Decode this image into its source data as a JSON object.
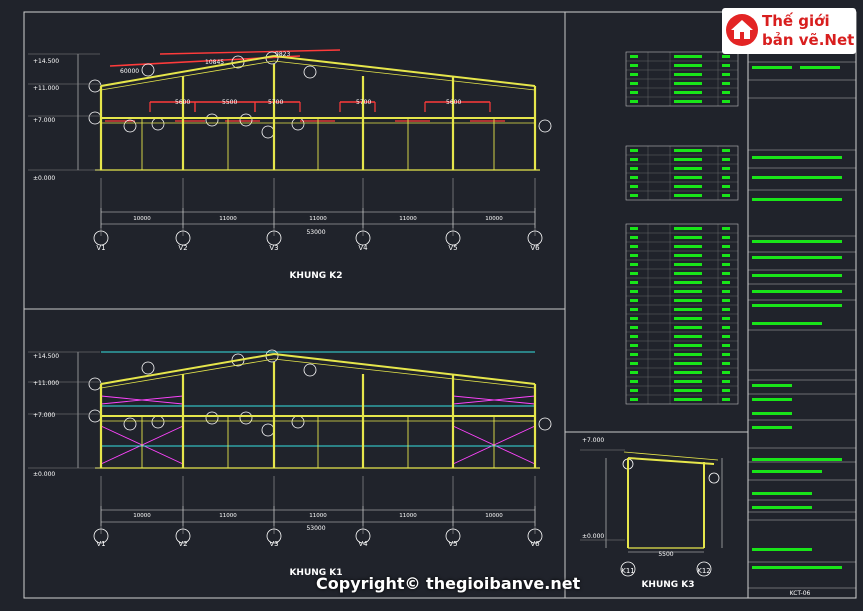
{
  "logo": {
    "line1": "Thế giới",
    "line2": "bản vẽ.Net"
  },
  "copyright": "Copyright© thegioibanve.net",
  "frames": {
    "k2": {
      "title": "KHUNG K2",
      "total": "53000",
      "bays": [
        "10000",
        "11000",
        "11000",
        "11000",
        "10000"
      ]
    },
    "k1": {
      "title": "KHUNG K1",
      "total": "53000",
      "bays": [
        "10000",
        "11000",
        "11000",
        "11000",
        "10000"
      ]
    },
    "k3": {
      "title": "KHUNG K3",
      "span": "5500"
    }
  },
  "levels": [
    "+14.500",
    "+11.000",
    "+7.000",
    "±0.000"
  ],
  "k3_levels": [
    "+7.000",
    "±0.000"
  ],
  "grid_axes": [
    "V1",
    "V2",
    "V3",
    "V4",
    "V5",
    "V6"
  ],
  "k3_axes": [
    "K11",
    "K12"
  ],
  "k2_dims": [
    "10845",
    "9823",
    "60000",
    "5600",
    "5500",
    "5700",
    "5700",
    "5600"
  ],
  "sheet_no": "KCT-06",
  "colors": {
    "frame": "#e6e64b",
    "beam": "#ff3b3b",
    "dim": "#d9d9d9",
    "grid": "#ffffff",
    "green": "#19e519",
    "cyan": "#36e0e0",
    "magenta": "#ff44ff"
  }
}
